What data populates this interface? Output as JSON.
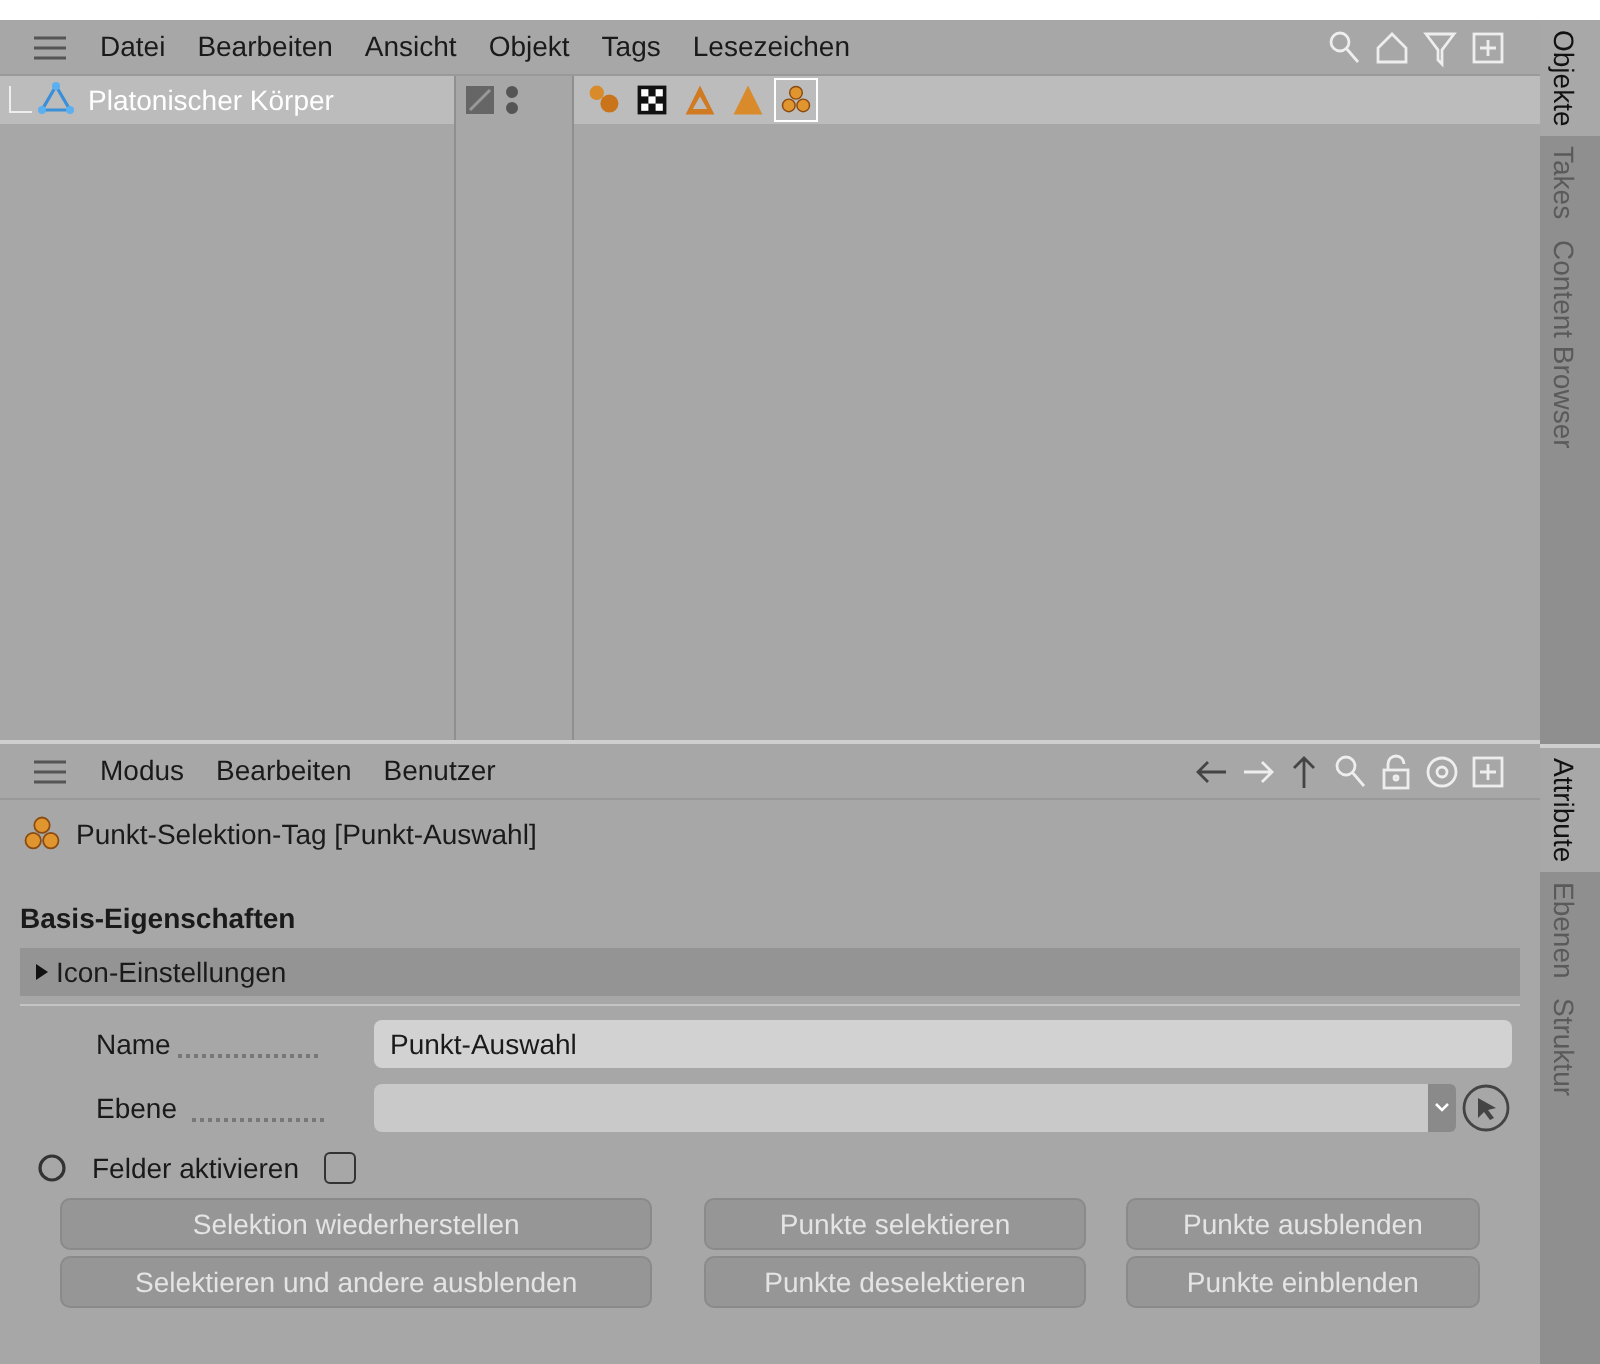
{
  "object_manager": {
    "menu": [
      "Datei",
      "Bearbeiten",
      "Ansicht",
      "Objekt",
      "Tags",
      "Lesezeichen"
    ],
    "objects": [
      {
        "name": "Platonischer Körper",
        "selected": true,
        "tags": [
          {
            "kind": "spheres",
            "selected": false
          },
          {
            "kind": "checker",
            "selected": false
          },
          {
            "kind": "triangle-outline",
            "selected": false
          },
          {
            "kind": "triangle",
            "selected": false
          },
          {
            "kind": "points",
            "selected": true
          }
        ]
      }
    ]
  },
  "side_tabs_top": [
    {
      "label": "Objekte",
      "selected": true
    },
    {
      "label": "Takes",
      "selected": false
    },
    {
      "label": "Content Browser",
      "selected": false
    }
  ],
  "attribute_manager": {
    "menu": [
      "Modus",
      "Bearbeiten",
      "Benutzer"
    ],
    "title": "Punkt-Selektion-Tag [Punkt-Auswahl]",
    "section": "Basis-Eigenschaften",
    "group": {
      "label": "Icon-Einstellungen",
      "expanded": false
    },
    "name_field": {
      "label": "Name",
      "value": "Punkt-Auswahl"
    },
    "layer_field": {
      "label": "Ebene"
    },
    "fields_toggle": {
      "label": "Felder aktivieren",
      "checked": false
    },
    "buttons": [
      [
        "Selektion wiederherstellen",
        "Punkte selektieren",
        "Punkte ausblenden"
      ],
      [
        "Selektieren und andere ausblenden",
        "Punkte deselektieren",
        "Punkte einblenden"
      ]
    ]
  },
  "side_tabs_bottom": [
    {
      "label": "Attribute",
      "selected": true
    },
    {
      "label": "Ebenen",
      "selected": false
    },
    {
      "label": "Struktur",
      "selected": false
    }
  ]
}
